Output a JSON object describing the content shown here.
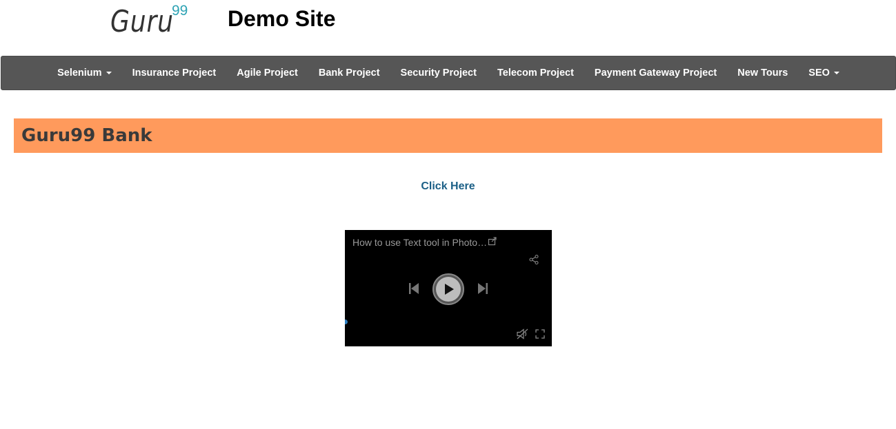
{
  "header": {
    "logo_text": "Guru",
    "logo_superscript": "99",
    "site_title": "Demo Site"
  },
  "nav": {
    "items": [
      {
        "label": "Selenium",
        "dropdown": true
      },
      {
        "label": "Insurance Project",
        "dropdown": false
      },
      {
        "label": "Agile Project",
        "dropdown": false
      },
      {
        "label": "Bank Project",
        "dropdown": false
      },
      {
        "label": "Security Project",
        "dropdown": false
      },
      {
        "label": "Telecom Project",
        "dropdown": false
      },
      {
        "label": "Payment Gateway Project",
        "dropdown": false
      },
      {
        "label": "New Tours",
        "dropdown": false
      },
      {
        "label": "SEO",
        "dropdown": true
      }
    ]
  },
  "banner": {
    "title": "Guru99 Bank"
  },
  "main": {
    "link_label": "Click Here"
  },
  "video": {
    "title": "How to use Text tool in Photo…",
    "icons": [
      "external-link-icon",
      "share-icon",
      "previous-icon",
      "play-icon",
      "next-icon",
      "mute-icon",
      "fullscreen-icon"
    ]
  },
  "colors": {
    "navbar_bg": "#565656",
    "banner_bg": "#ff9a5c",
    "link": "#1b5f86",
    "logo_accent": "#2ea3b4"
  }
}
